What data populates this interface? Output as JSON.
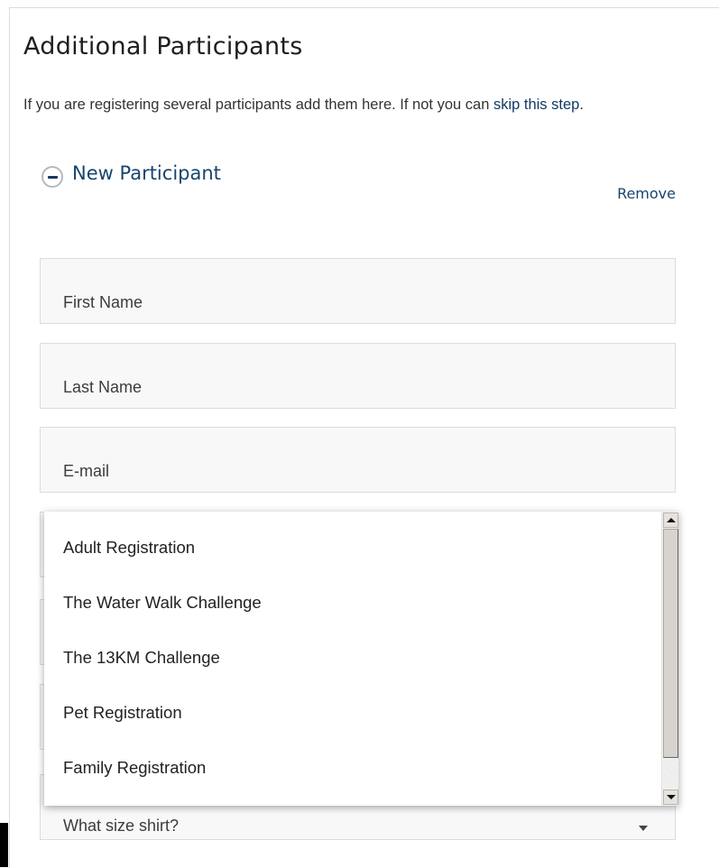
{
  "section": {
    "title": "Additional Participants",
    "intro_text": "If you are registering several participants add them here. If not you can ",
    "skip_link": "skip this step",
    "intro_end": "."
  },
  "participant": {
    "title": "New Participant",
    "remove_label": "Remove"
  },
  "form": {
    "first_name_placeholder": "First Name",
    "last_name_placeholder": "Last Name",
    "email_placeholder": "E-mail",
    "shirt_select_value": "What size shirt?"
  },
  "dropdown": {
    "options": [
      "Adult Registration",
      "The Water Walk Challenge",
      "The 13KM Challenge",
      "Pet Registration",
      "Family Registration"
    ]
  },
  "colors": {
    "accent": "#17456e",
    "field_background": "#f8f8f8",
    "field_border": "#dcdcdc"
  }
}
